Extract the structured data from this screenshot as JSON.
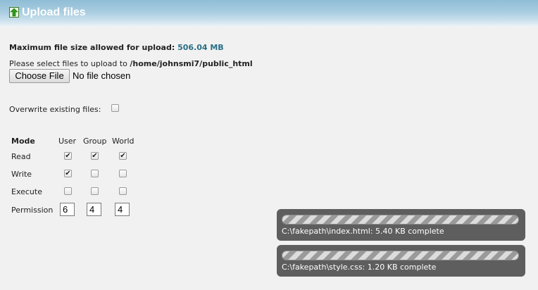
{
  "header": {
    "title": "Upload files",
    "icon": "green-up-arrow-icon"
  },
  "upload": {
    "max_label": "Maximum file size allowed for upload:",
    "max_value": "506.04 MB",
    "select_label": "Please select files to upload to",
    "select_path": "/home/johnsmi7/public_html",
    "choose_button": "Choose File",
    "no_file": "No file chosen",
    "overwrite_label": "Overwrite existing files:",
    "overwrite_checked": false
  },
  "permissions": {
    "mode_label": "Mode",
    "columns": [
      "User",
      "Group",
      "World"
    ],
    "rows": [
      {
        "label": "Read",
        "values": [
          true,
          true,
          true
        ]
      },
      {
        "label": "Write",
        "values": [
          true,
          false,
          false
        ]
      },
      {
        "label": "Execute",
        "values": [
          false,
          false,
          false
        ]
      }
    ],
    "permission_label": "Permission",
    "permission_values": [
      "6",
      "4",
      "4"
    ]
  },
  "progress": [
    {
      "text": "C:\\fakepath\\index.html: 5.40 KB complete",
      "fraction": 1.0
    },
    {
      "text": "C:\\fakepath\\style.css: 1.20 KB complete",
      "fraction": 1.0
    }
  ],
  "colors": {
    "accent": "#2b6f86",
    "progress_bg": "#5e5e5e"
  }
}
